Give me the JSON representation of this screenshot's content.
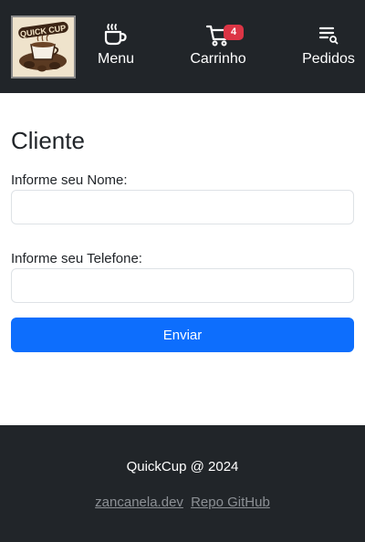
{
  "navbar": {
    "logo_text": "QUICK CUP",
    "items": [
      {
        "label": "Menu",
        "icon": "coffee-cup-icon"
      },
      {
        "label": "Carrinho",
        "icon": "cart-icon",
        "badge": "4"
      },
      {
        "label": "Pedidos",
        "icon": "orders-list-icon"
      }
    ]
  },
  "main": {
    "title": "Cliente",
    "name_field": {
      "label": "Informe seu Nome:",
      "value": ""
    },
    "phone_field": {
      "label": "Informe seu Telefone:",
      "value": ""
    },
    "submit_label": "Enviar"
  },
  "footer": {
    "copyright": "QuickCup @ 2024",
    "links": [
      "zancanela.dev",
      "Repo GitHub"
    ]
  },
  "colors": {
    "navbar_bg": "#212529",
    "primary": "#0d6efd",
    "badge": "#dc3545",
    "link": "#8c9095"
  }
}
